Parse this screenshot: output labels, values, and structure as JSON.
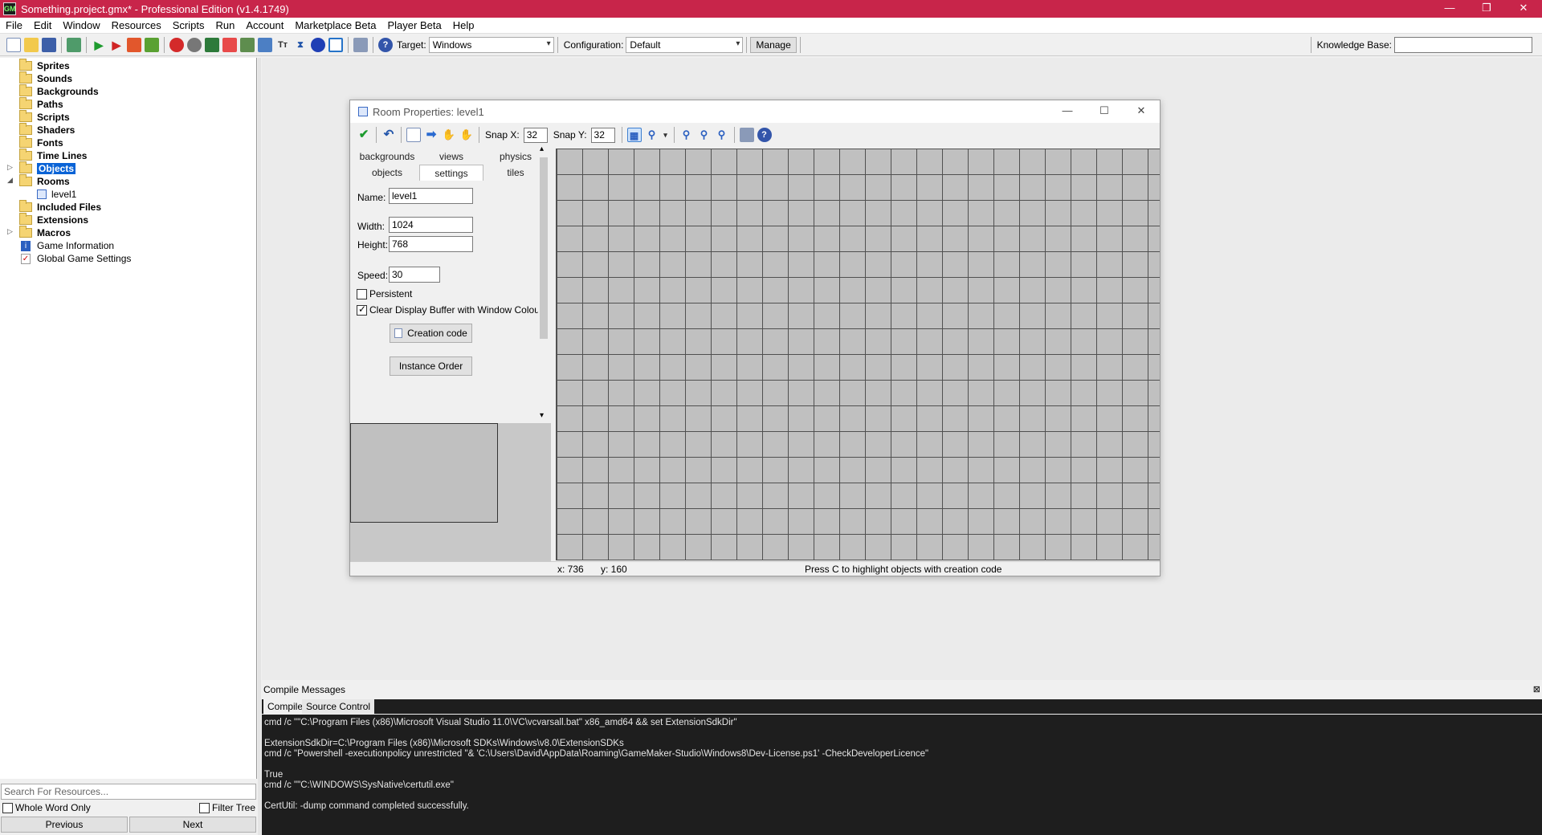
{
  "window": {
    "title": "Something.project.gmx*  -  Professional Edition (v1.4.1749)",
    "controls": [
      "—",
      "❐",
      "✕"
    ]
  },
  "menu": [
    "File",
    "Edit",
    "Window",
    "Resources",
    "Scripts",
    "Run",
    "Account",
    "Marketplace Beta",
    "Player Beta",
    "Help"
  ],
  "toolbar": {
    "target_label": "Target:",
    "target_value": "Windows",
    "config_label": "Configuration:",
    "config_value": "Default",
    "manage_label": "Manage",
    "kb_label": "Knowledge Base:"
  },
  "tree": {
    "items": [
      {
        "label": "Sprites"
      },
      {
        "label": "Sounds"
      },
      {
        "label": "Backgrounds"
      },
      {
        "label": "Paths"
      },
      {
        "label": "Scripts"
      },
      {
        "label": "Shaders"
      },
      {
        "label": "Fonts"
      },
      {
        "label": "Time Lines"
      },
      {
        "label": "Objects"
      },
      {
        "label": "Rooms"
      },
      {
        "label": "level1"
      },
      {
        "label": "Included Files"
      },
      {
        "label": "Extensions"
      },
      {
        "label": "Macros"
      },
      {
        "label": "Game Information"
      },
      {
        "label": "Global Game Settings"
      }
    ],
    "search_placeholder": "Search For Resources...",
    "whole_word": "Whole Word Only",
    "filter_tree": "Filter Tree",
    "previous": "Previous",
    "next": "Next"
  },
  "room": {
    "title": "Room Properties: level1",
    "snap_x_label": "Snap X:",
    "snap_x": "32",
    "snap_y_label": "Snap Y:",
    "snap_y": "32",
    "tabs_row1": [
      "backgrounds",
      "views",
      "physics"
    ],
    "tabs_row2": [
      "objects",
      "settings",
      "tiles"
    ],
    "name_label": "Name:",
    "name": "level1",
    "width_label": "Width:",
    "width": "1024",
    "height_label": "Height:",
    "height": "768",
    "speed_label": "Speed:",
    "speed": "30",
    "persistent": "Persistent",
    "clear_display": "Clear Display Buffer with Window Colour",
    "creation_code": "Creation code",
    "instance_order": "Instance Order",
    "status_x": "x: 736",
    "status_y": "y: 160",
    "status_msg": "Press C to highlight objects with creation code"
  },
  "compile": {
    "header": "Compile Messages",
    "tab_compile": "Compile",
    "tab_source": "Source Control",
    "log": "cmd /c \"\"C:\\Program Files (x86)\\Microsoft Visual Studio 11.0\\VC\\vcvarsall.bat\" x86_amd64 && set ExtensionSdkDir\"\n\nExtensionSdkDir=C:\\Program Files (x86)\\Microsoft SDKs\\Windows\\v8.0\\ExtensionSDKs\ncmd /c \"Powershell -executionpolicy unrestricted \"& 'C:\\Users\\David\\AppData\\Roaming\\GameMaker-Studio\\Windows8\\Dev-License.ps1' -CheckDeveloperLicence\"\n\nTrue\ncmd /c \"\"C:\\WINDOWS\\SysNative\\certutil.exe\"\n\nCertUtil: -dump command completed successfully."
  }
}
